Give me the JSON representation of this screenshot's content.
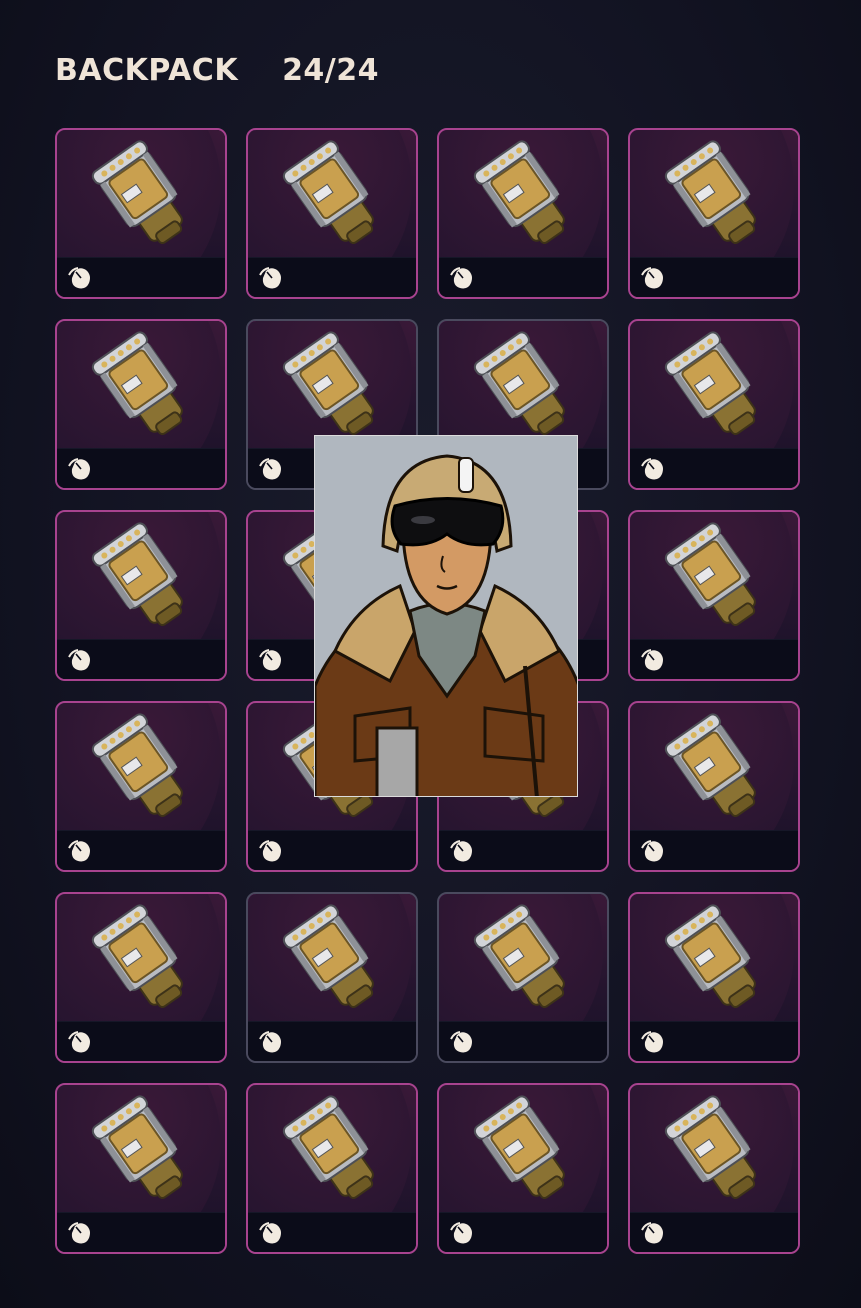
{
  "header": {
    "title": "BACKPACK",
    "count": "24/24"
  },
  "slots": [
    {
      "item": "canister",
      "icon": "mouse-icon"
    },
    {
      "item": "canister",
      "icon": "mouse-icon"
    },
    {
      "item": "canister",
      "icon": "mouse-icon"
    },
    {
      "item": "canister",
      "icon": "mouse-icon"
    },
    {
      "item": "canister",
      "icon": "mouse-icon"
    },
    {
      "item": "canister",
      "icon": "mouse-icon"
    },
    {
      "item": "canister",
      "icon": "mouse-icon"
    },
    {
      "item": "canister",
      "icon": "mouse-icon"
    },
    {
      "item": "canister",
      "icon": "mouse-icon"
    },
    {
      "item": "canister",
      "icon": "mouse-icon"
    },
    {
      "item": "canister",
      "icon": "mouse-icon"
    },
    {
      "item": "canister",
      "icon": "mouse-icon"
    },
    {
      "item": "canister",
      "icon": "mouse-icon"
    },
    {
      "item": "canister",
      "icon": "mouse-icon"
    },
    {
      "item": "canister",
      "icon": "mouse-icon"
    },
    {
      "item": "canister",
      "icon": "mouse-icon"
    },
    {
      "item": "canister",
      "icon": "mouse-icon"
    },
    {
      "item": "canister",
      "icon": "mouse-icon"
    },
    {
      "item": "canister",
      "icon": "mouse-icon"
    },
    {
      "item": "canister",
      "icon": "mouse-icon"
    },
    {
      "item": "canister",
      "icon": "mouse-icon"
    },
    {
      "item": "canister",
      "icon": "mouse-icon"
    },
    {
      "item": "canister",
      "icon": "mouse-icon"
    },
    {
      "item": "canister",
      "icon": "mouse-icon"
    }
  ],
  "overlay": {
    "subject": "pilot-portrait"
  },
  "colors": {
    "rarity_accent": "#c433a3",
    "slot_border": "#a8438f",
    "text": "#efe4d7",
    "background": "#121322"
  }
}
